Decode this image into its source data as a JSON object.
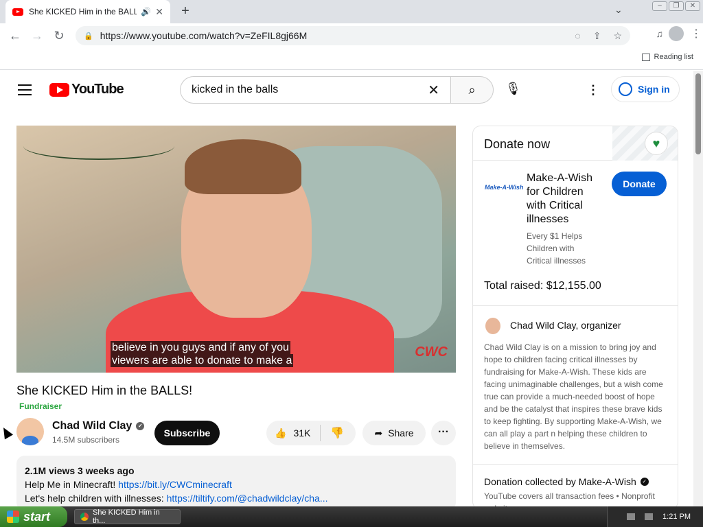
{
  "browser": {
    "tab_title": "She KICKED Him in the BALLS!",
    "url": "https://www.youtube.com/watch?v=ZeFIL8gj66M",
    "reading_list": "Reading list"
  },
  "youtube": {
    "logo_text": "YouTube",
    "search_value": "kicked in the balls",
    "sign_in": "Sign in"
  },
  "video": {
    "caption_line1": "believe in you guys and if any of you",
    "caption_line2": "viewers are able to donate to make a",
    "watermark": "CWC",
    "title": "She KICKED Him in the BALLS!",
    "fundraiser_label": "Fundraiser",
    "channel_name": "Chad Wild Clay",
    "subscribers": "14.5M subscribers",
    "subscribe_label": "Subscribe",
    "likes": "31K",
    "share_label": "Share",
    "more_label": "···",
    "desc_stats": "2.1M views  3 weeks ago",
    "desc_line1_text": "Help Me in Minecraft! ",
    "desc_line1_link": "https://bit.ly/CWCminecraft",
    "desc_line2_text": "Let's help children with illnesses: ",
    "desc_line2_link": "https://tiltify.com/@chadwildclay/cha..."
  },
  "donate": {
    "header": "Donate now",
    "logo_text": "Make-A-Wish",
    "charity_name": "Make-A-Wish for Children with Critical illnesses",
    "charity_desc": "Every $1 Helps Children with Critical illnesses",
    "donate_label": "Donate",
    "total_raised": "Total raised: $12,155.00",
    "organizer_name": "Chad Wild Clay",
    "organizer_suffix": ", organizer",
    "organizer_desc": "Chad Wild Clay is on a mission to bring joy and hope to children facing critical illnesses by fundraising for Make-A-Wish. These kids are facing unimaginable challenges, but a wish come true can provide a much-needed boost of hope and be the catalyst that inspires these brave kids to keep fighting. By supporting Make-A-Wish, we can all play a part n helping these children to believe in themselves.",
    "collected_by": "Donation collected by Make-A-Wish",
    "fees": "YouTube covers all transaction fees  •  Nonprofit website"
  },
  "taskbar": {
    "start_label": "start",
    "task_title": "She KICKED Him in th...",
    "clock": "1:21 PM"
  },
  "colors": {
    "yt_red": "#ff0000",
    "link_blue": "#065fd4",
    "fundraiser_green": "#2ba640"
  }
}
